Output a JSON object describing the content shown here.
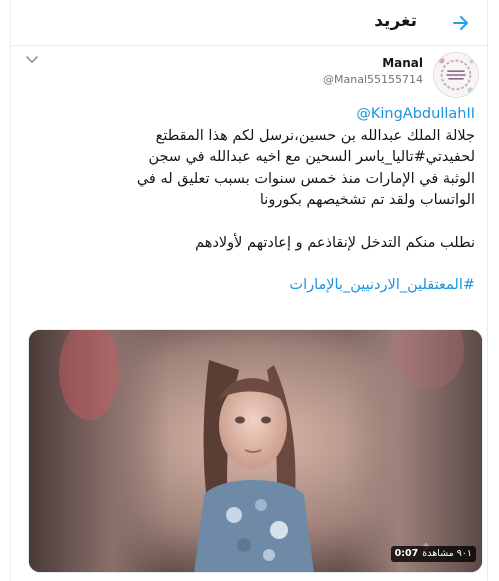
{
  "header": {
    "title": "تغريد"
  },
  "author": {
    "display_name": "Manal",
    "handle": "@Manal55155714"
  },
  "tweet": {
    "mention": "@KingAbdullahII",
    "lines": [
      "جلالة الملك عبدالله بن حسين،نرسل لكم هذا المقطتع",
      "لحفيدتي#تاليا_ياسر السحين مع اخيه عبدالله في سجن",
      "الوثبة في الإمارات منذ خمس سنوات بسبب تعليق له في",
      "الواتساب ولقد تم تشخيصهم بكورونا"
    ],
    "request": "نطلب منكم التدخل لإنقاذعم و إعادتهم لأولادهم",
    "hashtag": "#المعتقلين_الاردنيين_بالإمارات"
  },
  "media": {
    "duration": "0:07",
    "views": "٩٠١ مشاهدة"
  },
  "colors": {
    "link": "#1b95e0",
    "accent": "#1da1f2",
    "text": "#14171a",
    "muted": "#657786"
  }
}
